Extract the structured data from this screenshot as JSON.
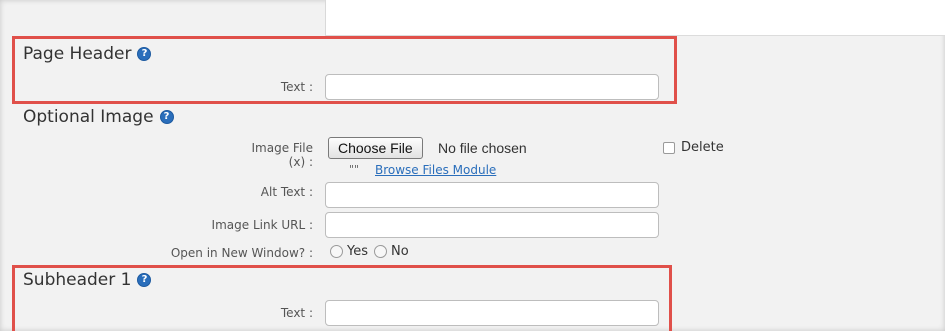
{
  "sections": {
    "page_header": {
      "title": "Page Header",
      "text_label": "Text :",
      "text_value": ""
    },
    "optional_image": {
      "title": "Optional Image",
      "image_file_label_line1": "Image File",
      "image_file_label_line2": "(x) :",
      "choose_file_label": "Choose File",
      "no_file_text": "No file chosen",
      "delete_label": "Delete",
      "quotes_text": "\"\"",
      "browse_link": "Browse Files Module",
      "alt_text_label": "Alt Text :",
      "alt_text_value": "",
      "link_url_label": "Image Link URL :",
      "link_url_value": "",
      "new_window_label": "Open in New Window? :",
      "yes_label": "Yes",
      "no_label": "No"
    },
    "subheader_1": {
      "title": "Subheader 1",
      "text_label": "Text :",
      "text_value": ""
    }
  },
  "help_icon_glyph": "?",
  "colors": {
    "highlight": "#e0504a",
    "help_icon": "#2a6ebb",
    "link": "#2a6ebb"
  }
}
